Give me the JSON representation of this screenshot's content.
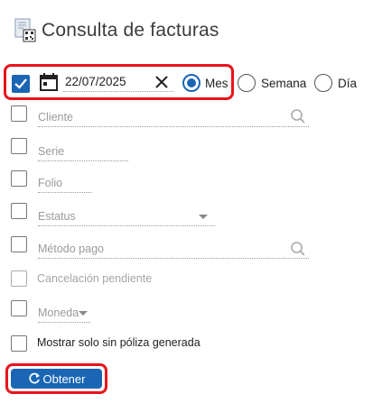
{
  "header": {
    "title": "Consulta de facturas",
    "icon": "document-qr-icon"
  },
  "date_filter": {
    "checked": true,
    "value": "22/07/2025",
    "period_options": [
      {
        "label": "Mes",
        "selected": true
      },
      {
        "label": "Semana",
        "selected": false
      },
      {
        "label": "Día",
        "selected": false
      }
    ]
  },
  "filters": {
    "cliente": {
      "placeholder": "Cliente"
    },
    "serie": {
      "placeholder": "Serie"
    },
    "folio": {
      "placeholder": "Folio"
    },
    "estatus": {
      "placeholder": "Estatus"
    },
    "metodo_pago": {
      "placeholder": "Método pago"
    },
    "cancelacion": {
      "label": "Cancelación pendiente"
    },
    "moneda": {
      "placeholder": "Moneda"
    },
    "poliza": {
      "label": "Mostrar solo sin póliza generada"
    }
  },
  "actions": {
    "obtener_label": "Obtener"
  },
  "colors": {
    "accent": "#1a66b5",
    "highlight": "#e8141b"
  }
}
